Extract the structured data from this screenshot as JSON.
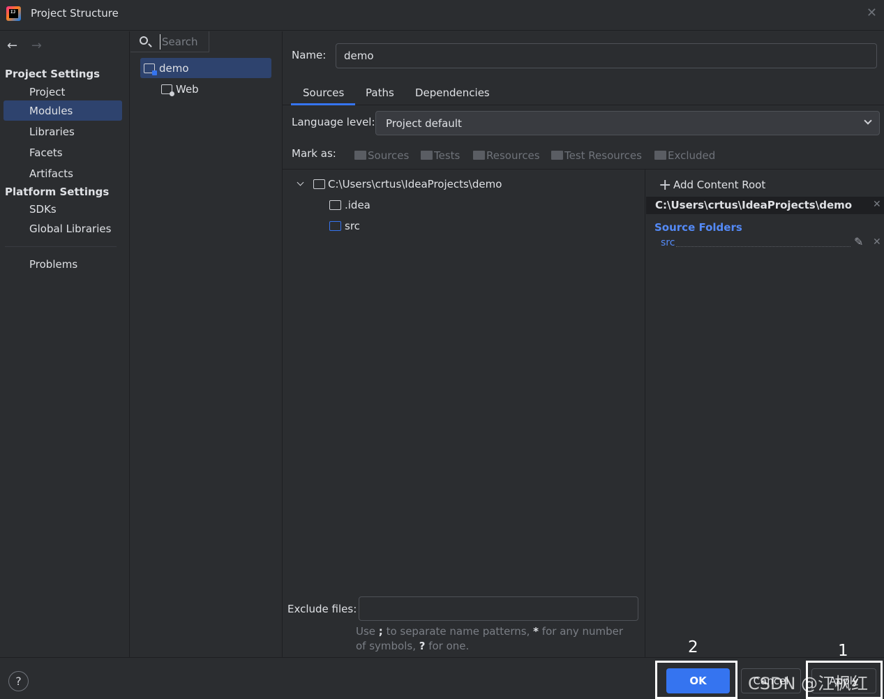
{
  "window": {
    "title": "Project Structure",
    "close_glyph": "✕",
    "logo_icon": "intellij-idea-icon",
    "logo_text": "IJ"
  },
  "nav": {
    "back_glyph": "←",
    "forward_glyph": "→",
    "project_settings_header": "Project Settings",
    "project_items": [
      "Project",
      "Modules",
      "Libraries",
      "Facets",
      "Artifacts"
    ],
    "platform_settings_header": "Platform Settings",
    "platform_items": [
      "SDKs",
      "Global Libraries"
    ],
    "problems": "Problems",
    "selected": "Modules"
  },
  "modules": {
    "search_placeholder": "Search",
    "items": [
      {
        "label": "demo",
        "icon": "module-icon",
        "selected": true
      },
      {
        "label": "Web",
        "icon": "web-facet-icon",
        "selected": false
      }
    ]
  },
  "main": {
    "name_label": "Name:",
    "name_value": "demo",
    "tabs": [
      "Sources",
      "Paths",
      "Dependencies"
    ],
    "active_tab": "Sources",
    "language_level_label": "Language level:",
    "language_level_value": "Project default",
    "mark_as_label": "Mark as:",
    "mark_as_options": [
      "Sources",
      "Tests",
      "Resources",
      "Test Resources",
      "Excluded"
    ],
    "tree": {
      "root": "C:\\Users\\crtus\\IdeaProjects\\demo",
      "children": [
        ".idea",
        "src"
      ]
    },
    "content_root": {
      "add_label": "Add Content Root",
      "path": "C:\\Users\\crtus\\IdeaProjects\\demo",
      "source_folders_label": "Source Folders",
      "source_folders": [
        "src"
      ]
    },
    "exclude_files_label": "Exclude files:",
    "exclude_files_value": "",
    "hint_parts": [
      "Use ",
      ";",
      " to separate name patterns, ",
      "*",
      " for any number of symbols, ",
      "?",
      " for one."
    ]
  },
  "footer": {
    "help_label": "?",
    "ok_label": "OK",
    "cancel_label": "Cancel",
    "apply_label": "Apply",
    "annotation_ok": "2",
    "annotation_apply": "1",
    "watermark": "CSDN @江枫红时"
  },
  "colors": {
    "accent": "#3574f0",
    "link": "#548af7",
    "selection": "#2e436e",
    "background": "#2b2d30"
  }
}
